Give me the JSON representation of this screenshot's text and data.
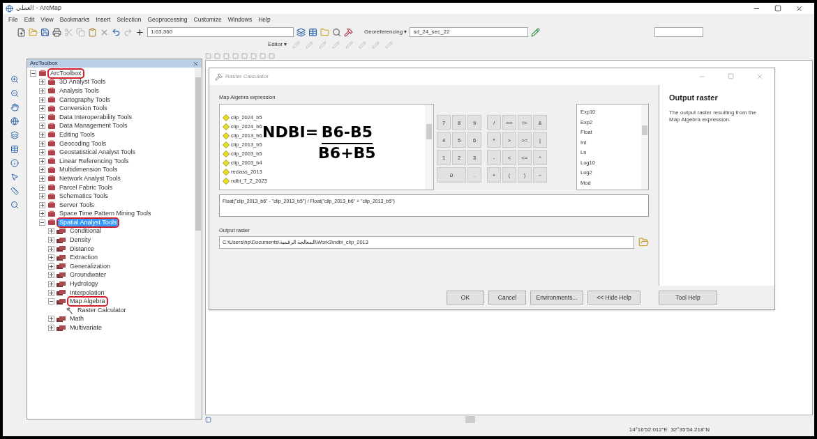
{
  "window": {
    "title": "العملي - ArcMap"
  },
  "menu": [
    "File",
    "Edit",
    "View",
    "Bookmarks",
    "Insert",
    "Selection",
    "Geoprocessing",
    "Customize",
    "Windows",
    "Help"
  ],
  "toolbar": {
    "scale": "1:63,360",
    "georeferencing": "Georeferencing ▾",
    "layer": "sd_24_sec_22",
    "editor": "Editor ▾"
  },
  "toolbox": {
    "title": "ArcToolbox",
    "tree": [
      {
        "label": "ArcToolbox",
        "kind": "root",
        "selected": false,
        "circled": true,
        "expanded": true,
        "children": [
          {
            "label": "3D Analyst Tools",
            "kind": "toolbox",
            "selected": false,
            "circled": false,
            "expanded": false
          },
          {
            "label": "Analysis Tools",
            "kind": "toolbox",
            "selected": false,
            "circled": false,
            "expanded": false
          },
          {
            "label": "Cartography Tools",
            "kind": "toolbox",
            "selected": false,
            "circled": false,
            "expanded": false
          },
          {
            "label": "Conversion Tools",
            "kind": "toolbox",
            "selected": false,
            "circled": false,
            "expanded": false
          },
          {
            "label": "Data Interoperability Tools",
            "kind": "toolbox",
            "selected": false,
            "circled": false,
            "expanded": false
          },
          {
            "label": "Data Management Tools",
            "kind": "toolbox",
            "selected": false,
            "circled": false,
            "expanded": false
          },
          {
            "label": "Editing Tools",
            "kind": "toolbox",
            "selected": false,
            "circled": false,
            "expanded": false
          },
          {
            "label": "Geocoding Tools",
            "kind": "toolbox",
            "selected": false,
            "circled": false,
            "expanded": false
          },
          {
            "label": "Geostatistical Analyst Tools",
            "kind": "toolbox",
            "selected": false,
            "circled": false,
            "expanded": false
          },
          {
            "label": "Linear Referencing Tools",
            "kind": "toolbox",
            "selected": false,
            "circled": false,
            "expanded": false
          },
          {
            "label": "Multidimension Tools",
            "kind": "toolbox",
            "selected": false,
            "circled": false,
            "expanded": false
          },
          {
            "label": "Network Analyst Tools",
            "kind": "toolbox",
            "selected": false,
            "circled": false,
            "expanded": false
          },
          {
            "label": "Parcel Fabric Tools",
            "kind": "toolbox",
            "selected": false,
            "circled": false,
            "expanded": false
          },
          {
            "label": "Schematics Tools",
            "kind": "toolbox",
            "selected": false,
            "circled": false,
            "expanded": false
          },
          {
            "label": "Server Tools",
            "kind": "toolbox",
            "selected": false,
            "circled": false,
            "expanded": false
          },
          {
            "label": "Space Time Pattern Mining Tools",
            "kind": "toolbox",
            "selected": false,
            "circled": false,
            "expanded": false
          },
          {
            "label": "Spatial Analyst Tools",
            "kind": "toolbox",
            "selected": true,
            "circled": true,
            "expanded": true,
            "children": [
              {
                "label": "Conditional",
                "kind": "toolset",
                "selected": false,
                "circled": false,
                "expanded": false
              },
              {
                "label": "Density",
                "kind": "toolset",
                "selected": false,
                "circled": false,
                "expanded": false
              },
              {
                "label": "Distance",
                "kind": "toolset",
                "selected": false,
                "circled": false,
                "expanded": false
              },
              {
                "label": "Extraction",
                "kind": "toolset",
                "selected": false,
                "circled": false,
                "expanded": false
              },
              {
                "label": "Generalization",
                "kind": "toolset",
                "selected": false,
                "circled": false,
                "expanded": false
              },
              {
                "label": "Groundwater",
                "kind": "toolset",
                "selected": false,
                "circled": false,
                "expanded": false
              },
              {
                "label": "Hydrology",
                "kind": "toolset",
                "selected": false,
                "circled": false,
                "expanded": false
              },
              {
                "label": "Interpolation",
                "kind": "toolset",
                "selected": false,
                "circled": false,
                "expanded": false
              },
              {
                "label": "Map Algebra",
                "kind": "toolset",
                "selected": false,
                "circled": true,
                "expanded": true,
                "children": [
                  {
                    "label": "Raster Calculator",
                    "kind": "tool",
                    "selected": false,
                    "circled": false
                  }
                ]
              },
              {
                "label": "Math",
                "kind": "toolset",
                "selected": false,
                "circled": false,
                "expanded": false
              },
              {
                "label": "Multivariate",
                "kind": "toolset",
                "selected": false,
                "circled": false,
                "expanded": false
              }
            ]
          }
        ]
      }
    ]
  },
  "dialog": {
    "title": "Raster Calculator",
    "expression_label": "Map Algebra expression",
    "layers": [
      "clip_2024_b5",
      "clip_2024_b6",
      "clip_2013_b6",
      "clip_2013_b5",
      "clip_2003_b5",
      "clip_2003_b4",
      "reclass_2013",
      "ndbi_7_2_2023"
    ],
    "formula": {
      "lhs": "NDBI=",
      "numerator": "B6-B5",
      "denominator": "B6+B5"
    },
    "keys": [
      [
        "7",
        "8",
        "9",
        "/",
        "==",
        "!=",
        "&"
      ],
      [
        "4",
        "5",
        "6",
        "*",
        ">",
        ">=",
        "|"
      ],
      [
        "1",
        "2",
        "3",
        "-",
        "<",
        "<=",
        "^"
      ],
      [
        "0",
        ".",
        "+",
        "(",
        ")",
        "~"
      ]
    ],
    "functions": [
      "Exp10",
      "Exp2",
      "Float",
      "Int",
      "Ln",
      "Log10",
      "Log2",
      "Mod"
    ],
    "expression": "Float(\"clip_2013_b6\" - \"clip_2013_b5\") / Float(\"clip_2013_b6\" + \"clip_2013_b5\")",
    "output_label": "Output raster",
    "output_value": "C:\\Users\\hp\\Documents\\المعالجة الرقمية\\Work3\\ndbi_clip_2013",
    "buttons": [
      "OK",
      "Cancel",
      "Environments...",
      "<< Hide Help"
    ],
    "tool_help": "Tool Help",
    "help": {
      "title": "Output raster",
      "text": "The output raster resulting from the Map Algebra expression."
    }
  },
  "status_bar": {
    "coordinates": "14°16'52.012\"E  32°35'54.218\"N"
  }
}
